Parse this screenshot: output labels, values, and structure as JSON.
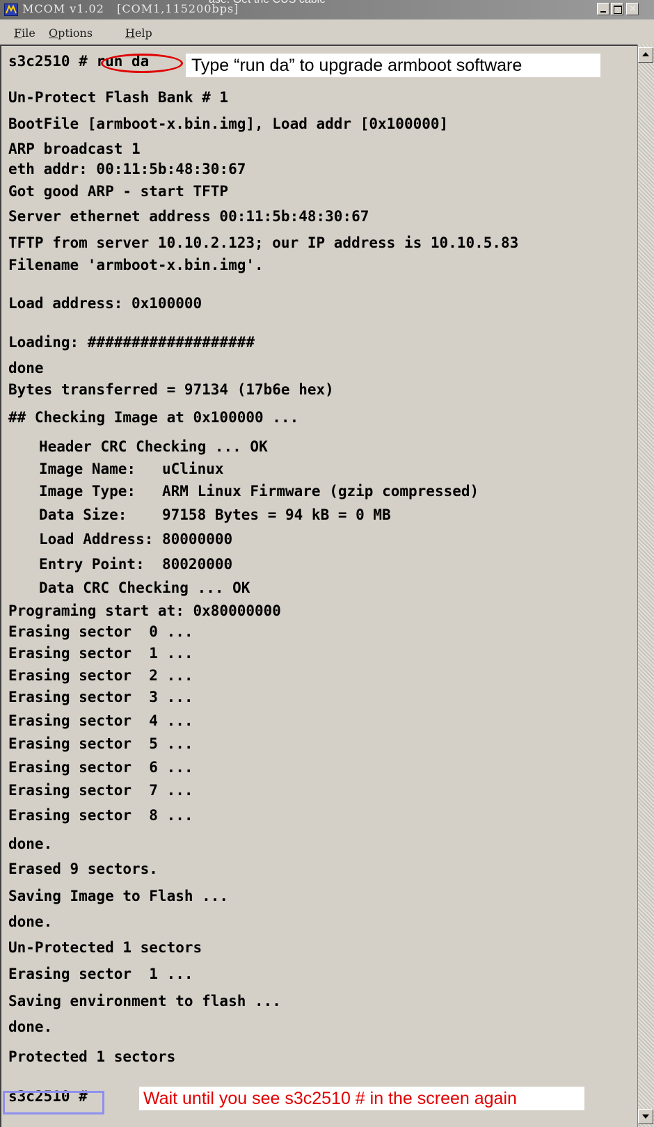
{
  "window": {
    "title": "MCOM v1.02   [COM1,115200bps]",
    "overflow_caption": "ase: Get the CUS cable"
  },
  "menu": {
    "file": {
      "mnemonic": "F",
      "rest": "ile"
    },
    "options": {
      "mnemonic": "O",
      "rest": "ptions"
    },
    "help": {
      "mnemonic": "H",
      "rest": "elp"
    }
  },
  "terminal": {
    "lines": [
      {
        "text": "s3c2510 # run da",
        "indent": false,
        "y": 0
      },
      {
        "text": "Un-Protect Flash Bank # 1",
        "indent": false
      },
      {
        "text": "BootFile [armboot-x.bin.img], Load addr [0x100000]",
        "indent": false
      },
      {
        "text": "ARP broadcast 1",
        "indent": false
      },
      {
        "text": "eth addr: 00:11:5b:48:30:67",
        "indent": false
      },
      {
        "text": "Got good ARP - start TFTP",
        "indent": false
      },
      {
        "text": "Server ethernet address 00:11:5b:48:30:67",
        "indent": false
      },
      {
        "text": "TFTP from server 10.10.2.123; our IP address is 10.10.5.83",
        "indent": false
      },
      {
        "text": "Filename 'armboot-x.bin.img'.",
        "indent": false
      },
      {
        "text": "Load address: 0x100000",
        "indent": false
      },
      {
        "text": "Loading: ###################",
        "indent": false
      },
      {
        "text": "done",
        "indent": false
      },
      {
        "text": "Bytes transferred = 97134 (17b6e hex)",
        "indent": false
      },
      {
        "text": "## Checking Image at 0x100000 ...",
        "indent": false
      },
      {
        "text": "Header CRC Checking ... OK",
        "indent": true
      },
      {
        "text": "Image Name:   uClinux",
        "indent": true
      },
      {
        "text": "Image Type:   ARM Linux Firmware (gzip compressed)",
        "indent": true
      },
      {
        "text": "Data Size:    97158 Bytes = 94 kB = 0 MB",
        "indent": true
      },
      {
        "text": "Load Address: 80000000",
        "indent": true
      },
      {
        "text": "Entry Point:  80020000",
        "indent": true
      },
      {
        "text": "Data CRC Checking ... OK",
        "indent": true
      },
      {
        "text": "Programing start at: 0x80000000",
        "indent": false
      },
      {
        "text": "Erasing sector  0 ...",
        "indent": false
      },
      {
        "text": "Erasing sector  1 ...",
        "indent": false
      },
      {
        "text": "Erasing sector  2 ...",
        "indent": false
      },
      {
        "text": "Erasing sector  3 ...",
        "indent": false
      },
      {
        "text": "Erasing sector  4 ...",
        "indent": false
      },
      {
        "text": "Erasing sector  5 ...",
        "indent": false
      },
      {
        "text": "Erasing sector  6 ...",
        "indent": false
      },
      {
        "text": "Erasing sector  7 ...",
        "indent": false
      },
      {
        "text": "Erasing sector  8 ...",
        "indent": false
      },
      {
        "text": "done.",
        "indent": false
      },
      {
        "text": "Erased 9 sectors.",
        "indent": false
      },
      {
        "text": "Saving Image to Flash ...",
        "indent": false
      },
      {
        "text": "done.",
        "indent": false
      },
      {
        "text": "Un-Protected 1 sectors",
        "indent": false
      },
      {
        "text": "Erasing sector  1 ...",
        "indent": false
      },
      {
        "text": "Saving environment to flash ...",
        "indent": false
      },
      {
        "text": "done.",
        "indent": false
      },
      {
        "text": "Protected 1 sectors",
        "indent": false
      },
      {
        "text": "s3c2510 #",
        "indent": false
      }
    ]
  },
  "annotations": {
    "top_note": "Type “run da” to upgrade armboot software",
    "bottom_note": "Wait until you see s3c2510 # in the screen again"
  },
  "colors": {
    "annotation_red": "#e00000",
    "prompt_box_blue": "#8f8ff0",
    "window_bg": "#d4d0c8"
  }
}
